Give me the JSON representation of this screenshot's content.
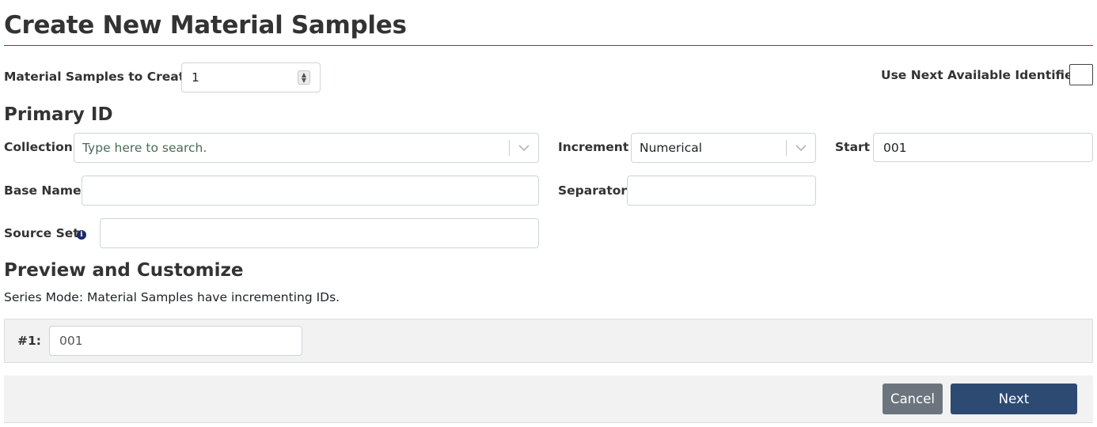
{
  "page": {
    "title": "Create New Material Samples"
  },
  "count": {
    "label": "Material Samples to Create",
    "value": "1"
  },
  "use_next": {
    "label": "Use Next Available Identifier",
    "checked": false
  },
  "primary_id": {
    "heading": "Primary ID",
    "collection": {
      "label": "Collection",
      "placeholder": "Type here to search."
    },
    "increment": {
      "label": "Increment",
      "value": "Numerical"
    },
    "start": {
      "label": "Start",
      "value": "001"
    },
    "base_name": {
      "label": "Base Name",
      "value": ""
    },
    "separator": {
      "label": "Separator",
      "value": ""
    },
    "source_set": {
      "label": "Source Set",
      "value": "",
      "info_icon": "info-icon"
    }
  },
  "preview": {
    "heading": "Preview and Customize",
    "mode_text": "Series Mode: Material Samples have incrementing IDs.",
    "rows": [
      {
        "label": "#1:",
        "value": "001"
      }
    ]
  },
  "footer": {
    "cancel_label": "Cancel",
    "next_label": "Next"
  },
  "colors": {
    "title_rule": "#7a3b47",
    "next_button": "#2d4a73",
    "cancel_button": "#6c757d",
    "preview_bg": "#f2f2f2"
  }
}
